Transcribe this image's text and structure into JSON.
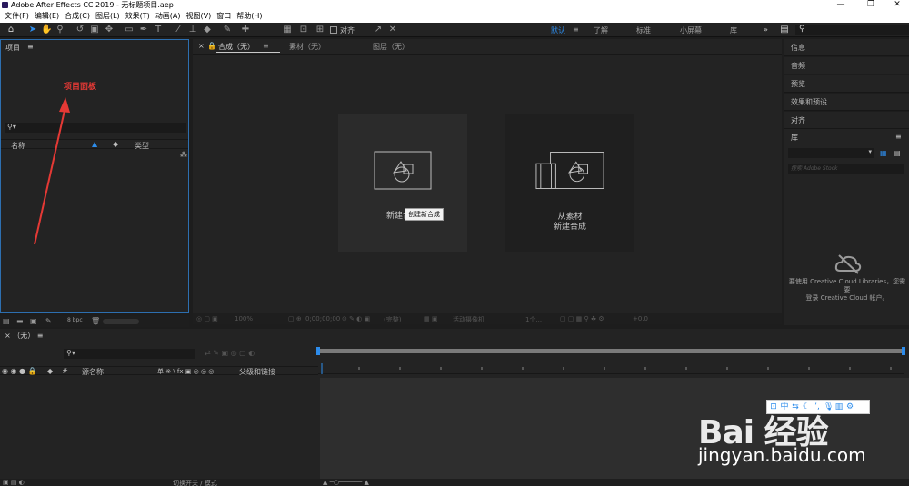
{
  "window": {
    "title": "Adobe After Effects CC 2019 - 无标题项目.aep",
    "minimize": "—",
    "maximize": "❐",
    "close": "✕"
  },
  "menu": [
    "文件(F)",
    "编辑(E)",
    "合成(C)",
    "图层(L)",
    "效果(T)",
    "动画(A)",
    "视图(V)",
    "窗口",
    "帮助(H)"
  ],
  "toolbar": {
    "align_label": "对齐",
    "workspaces": [
      "默认",
      "了解",
      "标准",
      "小屏幕",
      "库"
    ],
    "more": "»"
  },
  "project": {
    "tab_label": "项目",
    "annotation": "项目面板",
    "col_name": "名称",
    "col_type": "类型",
    "bpc": "8 bpc"
  },
  "comp": {
    "tabs": [
      "合成（无）",
      "素材（无）",
      "图层（无）"
    ],
    "new_comp_label": "新建合成",
    "from_footage_line1": "从素材",
    "from_footage_line2": "新建合成",
    "tooltip": "创建新合成",
    "zoom": "100%",
    "timecode": "0;00;00;00",
    "view": "(完整)",
    "camera": "活动摄像机",
    "views": "1个...",
    "offset": "+0.0"
  },
  "right_panels": {
    "info": "信息",
    "audio": "音频",
    "preview": "预览",
    "effects": "效果和预设",
    "align": "对齐",
    "library": "库",
    "lib_search_placeholder": "搜索 Adobe Stock",
    "lib_message_1": "要使用 Creative Cloud Libraries，您需要",
    "lib_message_2": "登录 Creative Cloud 帐户。"
  },
  "timeline": {
    "tab_label": "（无）",
    "col_source": "源名称",
    "col_parent": "父级和链接",
    "col_switches": "单 ※ \\ fx ▣ ◎ ◎ ◎",
    "toggle_modes": "切换开关 / 模式"
  },
  "watermark": {
    "brand": "Bai 经验",
    "url": "jingyan.baidu.com"
  }
}
